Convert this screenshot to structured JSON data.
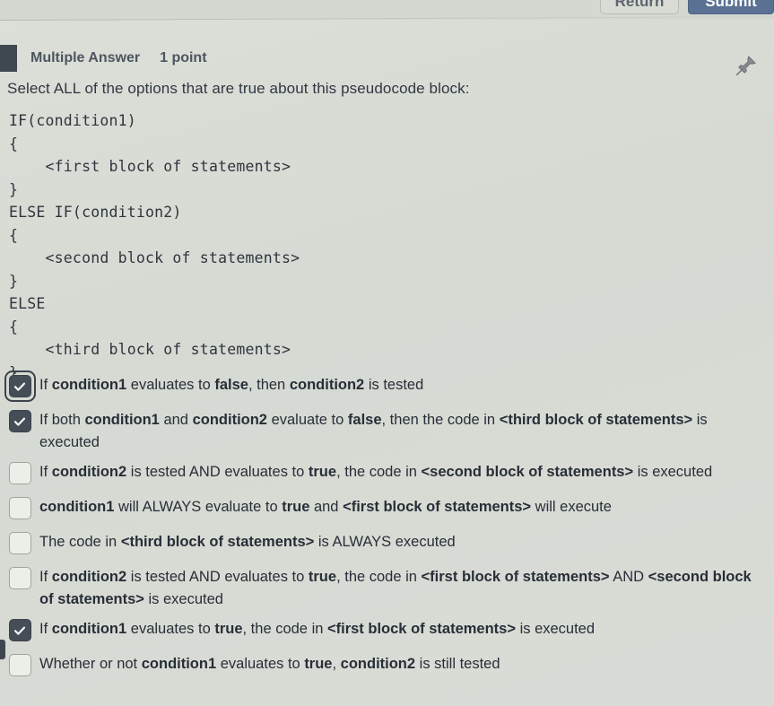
{
  "toolbar": {
    "return_label": "Return",
    "submit_label": "Submit",
    "pin_icon": "pushpin-icon"
  },
  "question": {
    "type_label": "Multiple Answer",
    "points_label": "1 point",
    "prompt": "Select ALL of the options that are true about this pseudocode block:",
    "pseudocode": "IF(condition1)\n{\n    <first block of statements>\n}\nELSE IF(condition2)\n{\n    <second block of statements>\n}\nELSE\n{\n    <third block of statements>\n}"
  },
  "options": [
    {
      "checked": true,
      "focused": true,
      "parts": [
        {
          "t": "If ",
          "b": false
        },
        {
          "t": "condition1",
          "b": true
        },
        {
          "t": " evaluates to ",
          "b": false
        },
        {
          "t": "false",
          "b": true
        },
        {
          "t": ", then ",
          "b": false
        },
        {
          "t": "condition2",
          "b": true
        },
        {
          "t": " is tested",
          "b": false
        }
      ]
    },
    {
      "checked": true,
      "focused": false,
      "parts": [
        {
          "t": "If both ",
          "b": false
        },
        {
          "t": "condition1",
          "b": true
        },
        {
          "t": " and ",
          "b": false
        },
        {
          "t": "condition2",
          "b": true
        },
        {
          "t": " evaluate to ",
          "b": false
        },
        {
          "t": "false",
          "b": true
        },
        {
          "t": ", then the code in ",
          "b": false
        },
        {
          "t": "<third block of statements>",
          "b": true
        },
        {
          "t": " is executed",
          "b": false
        }
      ]
    },
    {
      "checked": false,
      "focused": false,
      "parts": [
        {
          "t": "If ",
          "b": false
        },
        {
          "t": "condition2",
          "b": true
        },
        {
          "t": " is tested AND evaluates to ",
          "b": false
        },
        {
          "t": "true",
          "b": true
        },
        {
          "t": ", the code in ",
          "b": false
        },
        {
          "t": "<second block of statements>",
          "b": true
        },
        {
          "t": " is executed",
          "b": false
        }
      ]
    },
    {
      "checked": false,
      "focused": false,
      "parts": [
        {
          "t": "condition1",
          "b": true
        },
        {
          "t": " will ALWAYS evaluate to ",
          "b": false
        },
        {
          "t": "true",
          "b": true
        },
        {
          "t": " and ",
          "b": false
        },
        {
          "t": "<first block of statements>",
          "b": true
        },
        {
          "t": " will execute",
          "b": false
        }
      ]
    },
    {
      "checked": false,
      "focused": false,
      "parts": [
        {
          "t": "The code in ",
          "b": false
        },
        {
          "t": "<third block of statements>",
          "b": true
        },
        {
          "t": " is ALWAYS executed",
          "b": false
        }
      ]
    },
    {
      "checked": false,
      "focused": false,
      "parts": [
        {
          "t": "If ",
          "b": false
        },
        {
          "t": "condition2",
          "b": true
        },
        {
          "t": " is tested AND evaluates to ",
          "b": false
        },
        {
          "t": "true",
          "b": true
        },
        {
          "t": ", the code in ",
          "b": false
        },
        {
          "t": "<first block of statements>",
          "b": true
        },
        {
          "t": " AND ",
          "b": false
        },
        {
          "t": "<second block of statements>",
          "b": true
        },
        {
          "t": " is executed",
          "b": false
        }
      ]
    },
    {
      "checked": true,
      "focused": false,
      "parts": [
        {
          "t": "If ",
          "b": false
        },
        {
          "t": "condition1",
          "b": true
        },
        {
          "t": " evaluates to ",
          "b": false
        },
        {
          "t": "true",
          "b": true
        },
        {
          "t": ", the code in ",
          "b": false
        },
        {
          "t": "<first block of statements>",
          "b": true
        },
        {
          "t": " is executed",
          "b": false
        }
      ]
    },
    {
      "checked": false,
      "focused": false,
      "parts": [
        {
          "t": "Whether or not ",
          "b": false
        },
        {
          "t": "condition1",
          "b": true
        },
        {
          "t": " evaluates to ",
          "b": false
        },
        {
          "t": "true",
          "b": true
        },
        {
          "t": ", ",
          "b": false
        },
        {
          "t": "condition2",
          "b": true
        },
        {
          "t": " is still tested",
          "b": false
        }
      ]
    }
  ],
  "colors": {
    "page_bg": "#d9dcd5",
    "submit_bg": "#5a7193",
    "checkbox_checked_bg": "#454d57",
    "marker": "#3f4750",
    "text": "#272e37"
  }
}
